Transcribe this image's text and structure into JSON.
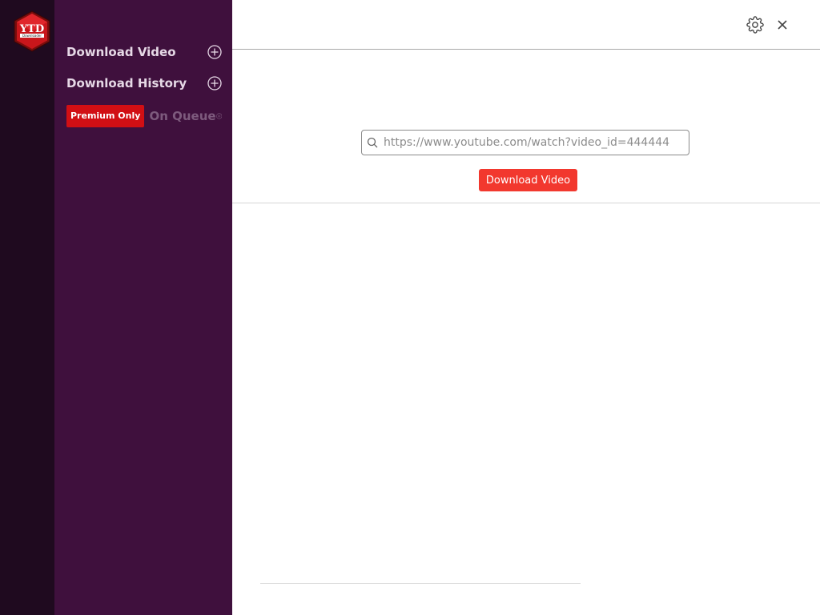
{
  "app": {
    "logo_text": "YTD",
    "logo_subtext": "Downloader"
  },
  "sidebar": {
    "items": [
      {
        "label": "Download Video",
        "icon": "plus-circle-icon"
      },
      {
        "label": "Download History",
        "icon": "plus-circle-icon"
      }
    ],
    "premium": {
      "badge": "Premium Only",
      "label": "On Queue",
      "icon": "plus-circle-icon"
    }
  },
  "topbar": {
    "icons": [
      "gear-icon",
      "close-icon"
    ]
  },
  "search": {
    "placeholder": "https://www.youtube.com/watch?video_id=444444",
    "icon": "search-icon"
  },
  "actions": {
    "download_label": "Download Video"
  },
  "colors": {
    "rail": "#1f0a1f",
    "sidebar": "#3f103d",
    "accent": "#f2382e",
    "premium": "#d10f14"
  }
}
